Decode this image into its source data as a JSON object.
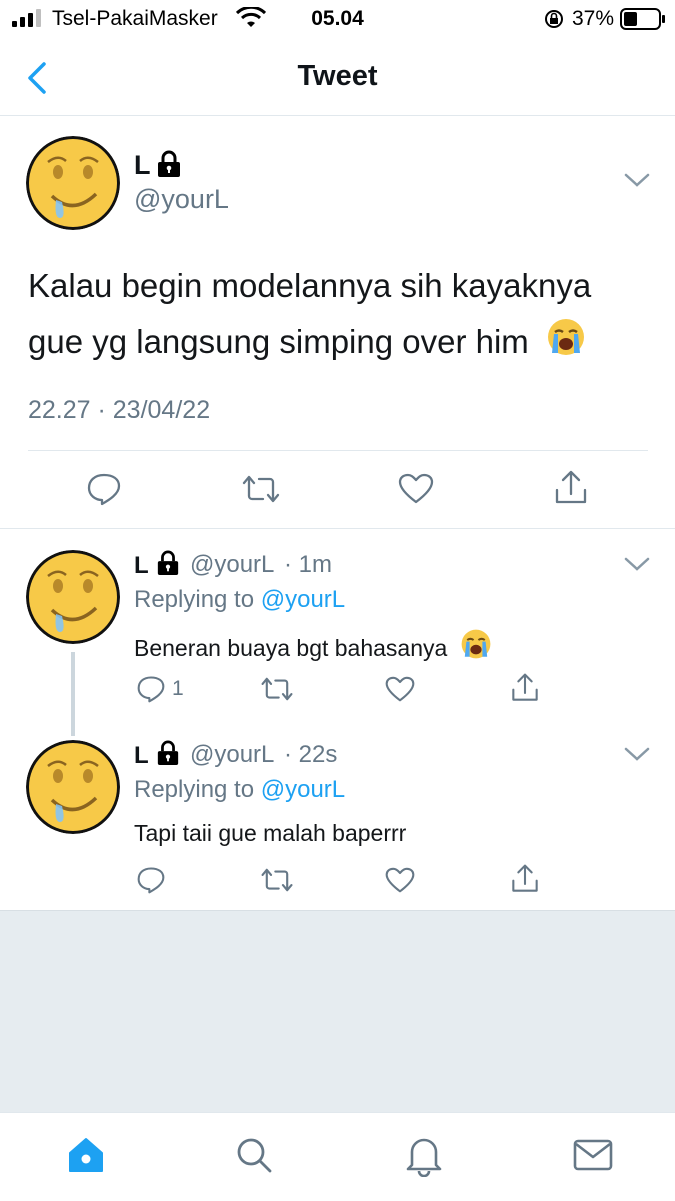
{
  "status_bar": {
    "carrier": "Tsel-PakaiMasker",
    "time": "05.04",
    "battery_percent": "37%"
  },
  "nav": {
    "title": "Tweet",
    "back_icon": "chevron-left-icon"
  },
  "main_tweet": {
    "name": "L",
    "handle": "@yourL",
    "text_line1": "Kalau begin modelannya sih kayaknya",
    "text_line2": "gue yg langsung simping over him",
    "timestamp": "22.27 · 23/04/22"
  },
  "replies": [
    {
      "name": "L",
      "handle": "@yourL",
      "age": "· 1m",
      "replying_prefix": "Replying to",
      "replying_handle": "@yourL",
      "text": "Beneran buaya bgt bahasanya",
      "reply_count": "1"
    },
    {
      "name": "L",
      "handle": "@yourL",
      "age": "· 22s",
      "replying_prefix": "Replying to",
      "replying_handle": "@yourL",
      "text": "Tapi taii gue malah baperrr",
      "reply_count": ""
    }
  ],
  "tabs": [
    "home-icon",
    "search-icon",
    "bell-icon",
    "mail-icon"
  ],
  "colors": {
    "accent": "#1da1f2",
    "secondary_text": "#657786",
    "background_gray": "#e6ecf0"
  }
}
